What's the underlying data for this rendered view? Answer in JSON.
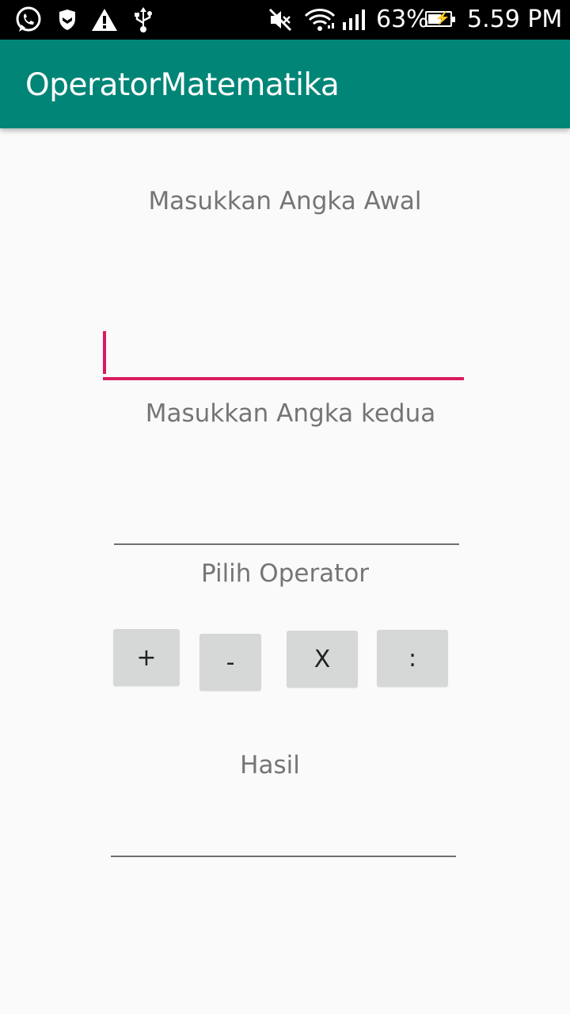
{
  "status_bar": {
    "icons": [
      "whatsapp-icon",
      "shield-icon",
      "warning-icon",
      "usb-icon",
      "mute-icon",
      "wifi-icon",
      "signal-icon",
      "battery-charging-icon"
    ],
    "battery_percent": "63%",
    "battery_level": 0.63,
    "time": "5.59 PM"
  },
  "app_bar": {
    "title": "OperatorMatematika",
    "color": "#008577"
  },
  "form": {
    "first_label": "Masukkan Angka Awal",
    "first_value": "",
    "second_label": "Masukkan Angka kedua",
    "second_value": "",
    "operator_label": "Pilih Operator",
    "operators": [
      "+",
      "-",
      "X",
      ":"
    ],
    "result_label": "Hasil",
    "result_value": ""
  },
  "colors": {
    "accent": "#D81B60",
    "label_text": "#757575",
    "button_bg": "#D6D7D7"
  }
}
